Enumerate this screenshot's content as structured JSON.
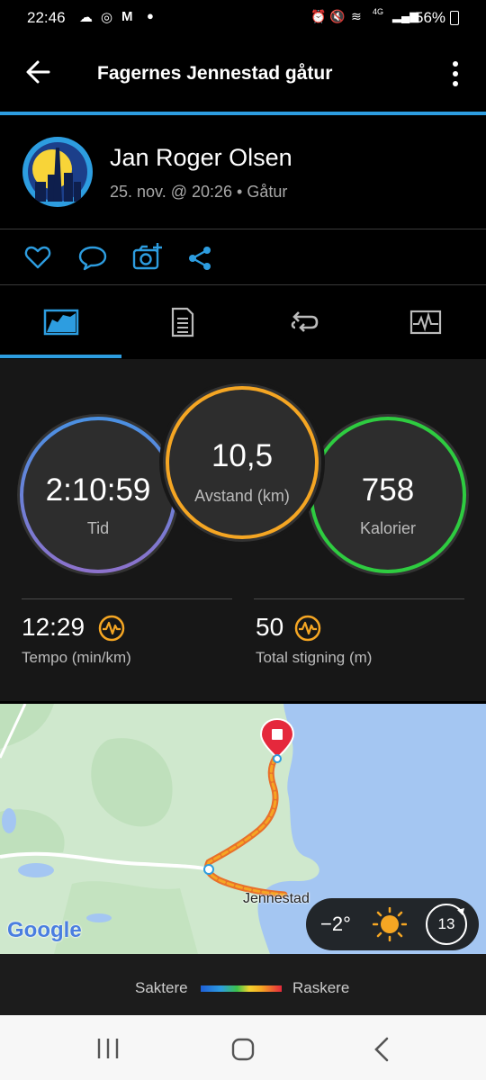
{
  "status_bar": {
    "time": "22:46",
    "network": "4G",
    "battery": "56%"
  },
  "header": {
    "title": "Fagernes Jennestad gåtur"
  },
  "profile": {
    "name": "Jan Roger Olsen",
    "meta": "25. nov. @ 20:26 • Gåtur"
  },
  "stats": {
    "time": {
      "value": "2:10:59",
      "label": "Tid"
    },
    "distance": {
      "value": "10,5",
      "label": "Avstand (km)"
    },
    "calories": {
      "value": "758",
      "label": "Kalorier"
    },
    "pace": {
      "value": "12:29",
      "label": "Tempo (min/km)"
    },
    "ascent": {
      "value": "50",
      "label": "Total stigning (m)"
    }
  },
  "map": {
    "place_label": "Jennestad",
    "google_logo": "Google",
    "temperature": "−2°",
    "wind_speed": "13"
  },
  "legend": {
    "slower": "Saktere",
    "faster": "Raskere"
  },
  "colors": {
    "accent": "#2d9de0",
    "time_ring": "#4a90e2",
    "distance_ring": "#f5a623",
    "calories_ring": "#2ecc40"
  }
}
